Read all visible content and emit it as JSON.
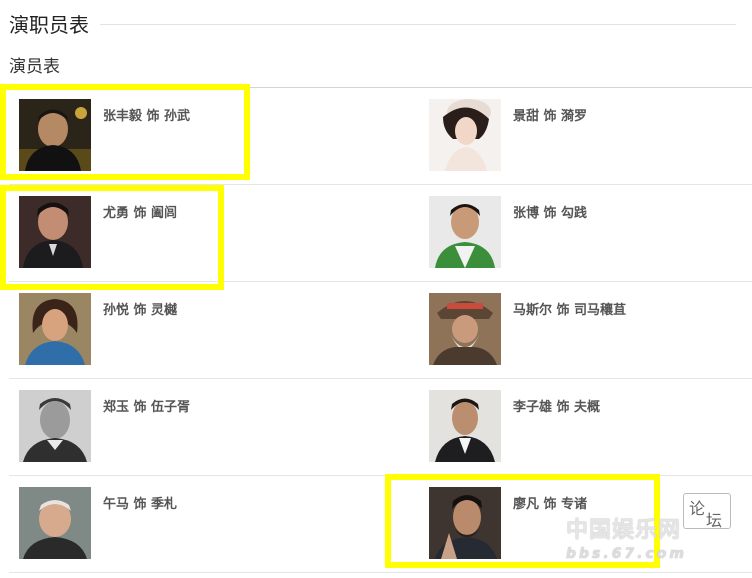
{
  "header": {
    "title": "演职员表"
  },
  "section": {
    "title": "演员表"
  },
  "cast": [
    {
      "role_text": "张丰毅 饰 孙武",
      "highlighted": true
    },
    {
      "role_text": "景甜 饰 漪罗",
      "highlighted": false
    },
    {
      "role_text": "尤勇 饰 阖闾",
      "highlighted": true
    },
    {
      "role_text": "张博 饰 勾践",
      "highlighted": false
    },
    {
      "role_text": "孙悦 饰 灵樾",
      "highlighted": false
    },
    {
      "role_text": "马斯尔 饰 司马穰苴",
      "highlighted": false
    },
    {
      "role_text": "郑玉 饰 伍子胥",
      "highlighted": false
    },
    {
      "role_text": "李子雄 饰 夫概",
      "highlighted": false
    },
    {
      "role_text": "午马 饰 季札",
      "highlighted": false
    },
    {
      "role_text": "廖凡 饰 专诸",
      "highlighted": true
    }
  ],
  "watermark": {
    "forum_char1": "论",
    "forum_char2": "坛",
    "logo_text": "中国娱乐网",
    "url_text": "bbs.67.com"
  },
  "colors": {
    "highlight": "#ffff00",
    "role_text": "#555555"
  }
}
